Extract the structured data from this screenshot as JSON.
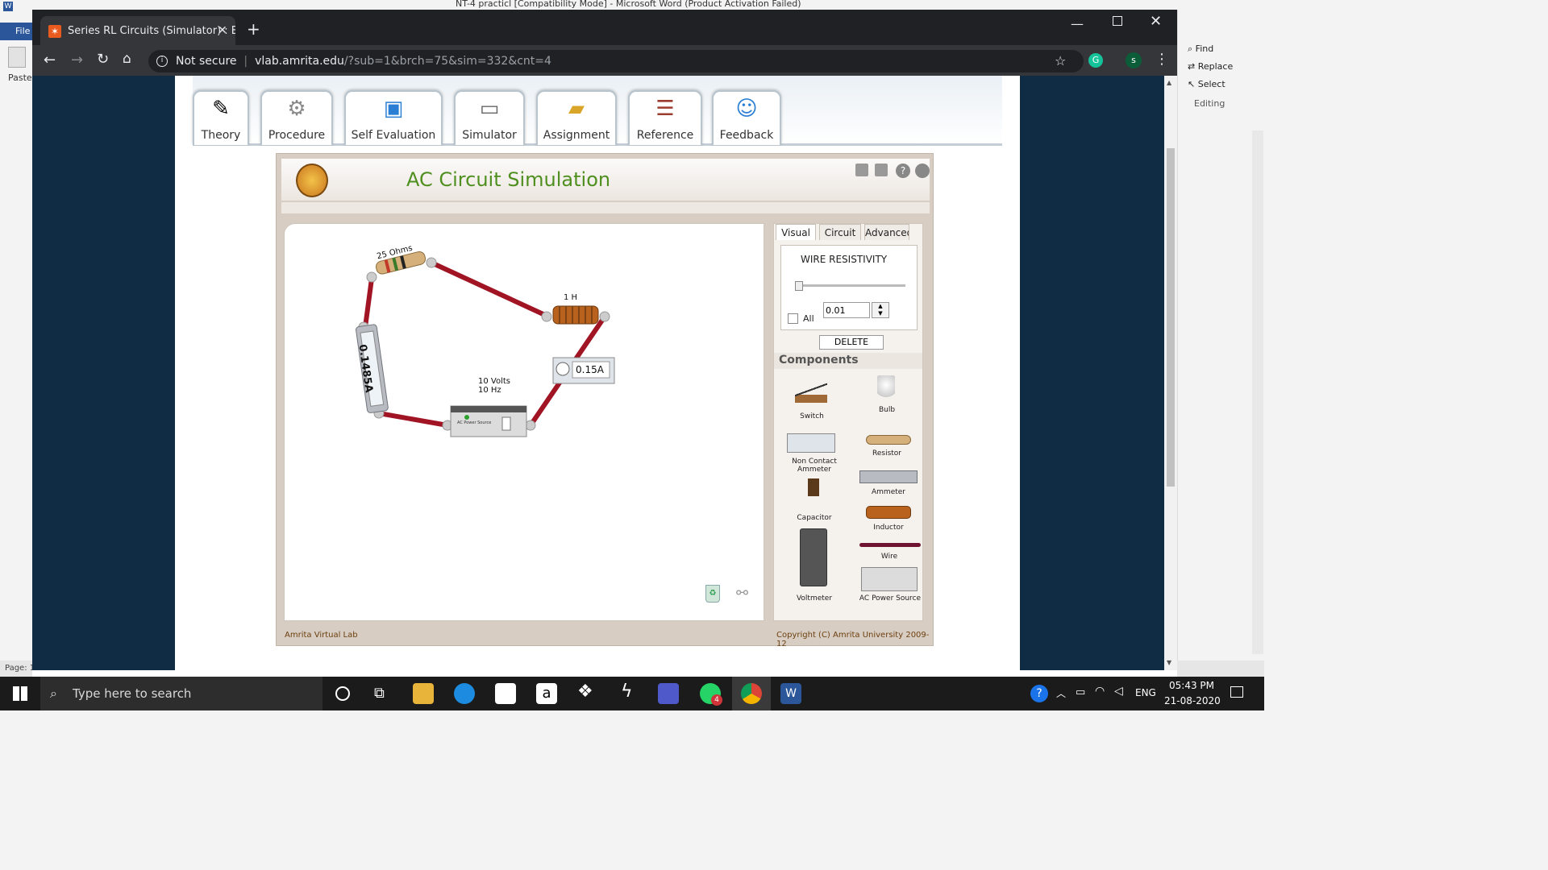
{
  "word": {
    "title_partial": "NT-4 practicl [Compatibility Mode] - Microsoft Word (Product Activation Failed)",
    "file_tab": "File",
    "paste_label": "Paste",
    "find_label": "Find",
    "replace_label": "Replace",
    "select_label": "Select",
    "editing_label": "Editing",
    "page_status": "Page: 1"
  },
  "browser": {
    "tab_title": "Series RL Circuits (Simulator) : Ele",
    "security": "Not secure",
    "url_host": "vlab.amrita.edu",
    "url_rest": "/?sub=1&brch=75&sim=332&cnt=4",
    "profile_initial": "s"
  },
  "nav_tabs": [
    {
      "label": "Theory",
      "icon": "pen-paper-icon"
    },
    {
      "label": "Procedure",
      "icon": "gears-icon"
    },
    {
      "label": "Self Evaluation",
      "icon": "monitor-chart-icon"
    },
    {
      "label": "Simulator",
      "icon": "monitor-icon"
    },
    {
      "label": "Assignment",
      "icon": "folder-icon"
    },
    {
      "label": "Reference",
      "icon": "books-icon"
    },
    {
      "label": "Feedback",
      "icon": "person-chat-icon"
    }
  ],
  "sim": {
    "title": "AC Circuit Simulation",
    "footer_left": "Amrita Virtual Lab",
    "footer_right": "Copyright (C) Amrita University 2009-12",
    "circuit": {
      "resistor_label": "25 Ohms",
      "inductor_label": "1 H",
      "ammeter_reading": "0.1485A",
      "noncontact_reading": "0.15A",
      "source_label_line1": "10 Volts",
      "source_label_line2": "10 Hz",
      "source_text": "AC Power Source"
    },
    "panel": {
      "tabs": [
        "Visual",
        "Circuit",
        "Advanced"
      ],
      "wire_resistivity_label": "WIRE RESISTIVITY",
      "all_label": "All",
      "resistivity_value": "0.01",
      "delete_label": "DELETE",
      "components_heading": "Components",
      "components": [
        {
          "label": "Switch"
        },
        {
          "label": "Bulb"
        },
        {
          "label": "Non Contact Ammeter"
        },
        {
          "label": "Resistor"
        },
        {
          "label": "Ammeter"
        },
        {
          "label": "Capacitor"
        },
        {
          "label": "Inductor"
        },
        {
          "label": "Wire"
        },
        {
          "label": "Voltmeter"
        },
        {
          "label": "AC Power Source"
        }
      ]
    }
  },
  "taskbar": {
    "search_placeholder": "Type here to search",
    "whatsapp_badge": "4",
    "language": "ENG",
    "time": "05:43 PM",
    "date": "21-08-2020"
  },
  "colors": {
    "wire": "#a01424",
    "title_green": "#4f8f1f",
    "page_bg": "#102b44"
  }
}
